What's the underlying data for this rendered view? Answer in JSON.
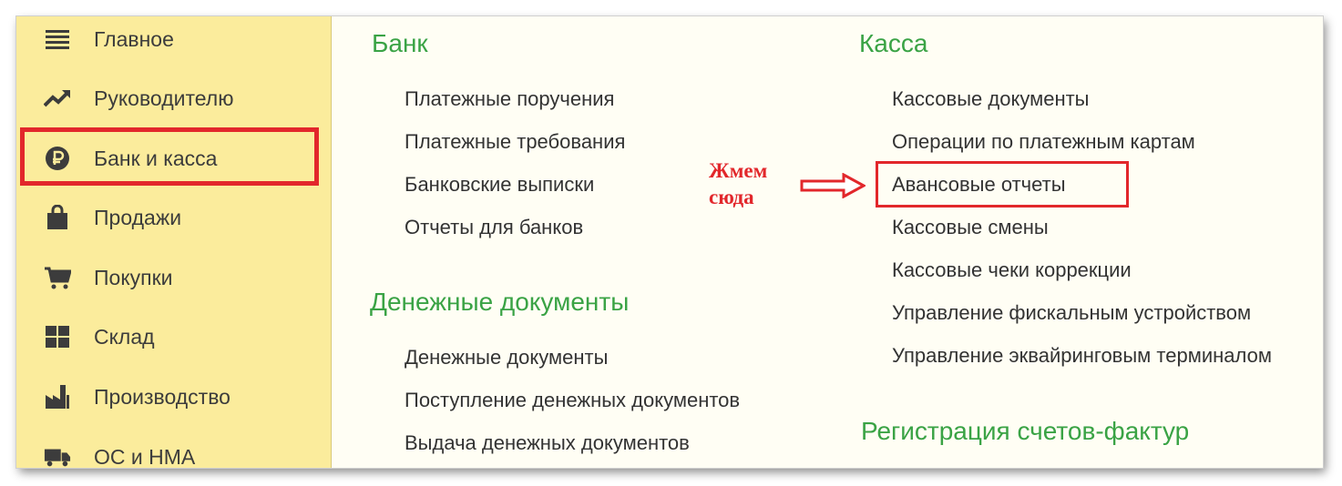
{
  "sidebar": {
    "items": [
      {
        "label": "Главное",
        "icon": "menu-icon"
      },
      {
        "label": "Руководителю",
        "icon": "trend-up-icon"
      },
      {
        "label": "Банк и касса",
        "icon": "ruble-icon",
        "active": true
      },
      {
        "label": "Продажи",
        "icon": "shopping-bag-icon"
      },
      {
        "label": "Покупки",
        "icon": "cart-icon"
      },
      {
        "label": "Склад",
        "icon": "warehouse-grid-icon"
      },
      {
        "label": "Производство",
        "icon": "factory-icon"
      },
      {
        "label": "ОС и НМА",
        "icon": "truck-icon"
      }
    ]
  },
  "groups": {
    "bank": {
      "title": "Банк",
      "links": [
        "Платежные поручения",
        "Платежные требования",
        "Банковские выписки",
        "Отчеты для банков"
      ]
    },
    "money_docs": {
      "title": "Денежные документы",
      "links": [
        "Денежные документы",
        "Поступление денежных документов",
        "Выдача денежных документов"
      ]
    },
    "kassa": {
      "title": "Касса",
      "links": [
        "Кассовые документы",
        "Операции по платежным картам",
        "Авансовые отчеты",
        "Кассовые смены",
        "Кассовые чеки коррекции",
        "Управление фискальным устройством",
        "Управление эквайринговым терминалом"
      ]
    },
    "invoices": {
      "title": "Регистрация счетов-фактур"
    }
  },
  "annotation": {
    "line1": "Жмем",
    "line2": "сюда"
  },
  "colors": {
    "sidebar_bg": "#fbec9c",
    "content_bg": "#fffef4",
    "group_title": "#3aa345",
    "annotation_red": "#e2272b"
  }
}
